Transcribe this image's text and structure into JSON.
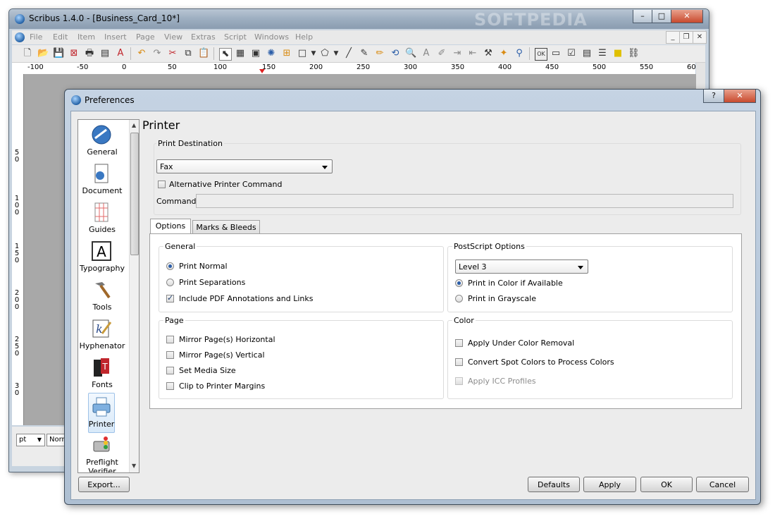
{
  "scribus": {
    "title": "Scribus 1.4.0 - [Business_Card_10*]",
    "menus": [
      "File",
      "Edit",
      "Item",
      "Insert",
      "Page",
      "View",
      "Extras",
      "Script",
      "Windows",
      "Help"
    ],
    "ruler_labels": [
      "-100",
      "-50",
      "0",
      "50",
      "100",
      "150",
      "200",
      "250",
      "300",
      "350",
      "400",
      "450",
      "500",
      "550",
      "60"
    ],
    "vruler_labels": [
      "5\n0",
      "1\n0\n0",
      "1\n5\n0",
      "2\n0\n0",
      "2\n5\n0",
      "3\n0"
    ],
    "units": "pt",
    "view_mode": "Norm",
    "window_controls": {
      "minimize": "–",
      "maximize": "□",
      "close": "✕"
    }
  },
  "watermark": "SOFTPEDIA",
  "prefs": {
    "title": "Preferences",
    "help_button": "?",
    "close_button": "✕",
    "sidebar": [
      "General",
      "Document",
      "Guides",
      "Typography",
      "Tools",
      "Hyphenator",
      "Fonts",
      "Printer",
      "Preflight Verifier"
    ],
    "selected": "Printer",
    "page_title": "Printer",
    "print_destination": {
      "title": "Print Destination",
      "selected": "Fax",
      "alt_command_label": "Alternative Printer Command",
      "alt_command_checked": false,
      "command_label": "Command:",
      "command_value": ""
    },
    "tabs": [
      "Options",
      "Marks & Bleeds"
    ],
    "active_tab": "Options",
    "general": {
      "title": "General",
      "options": [
        {
          "label": "Print Normal",
          "type": "radio",
          "checked": true
        },
        {
          "label": "Print Separations",
          "type": "radio",
          "checked": false
        },
        {
          "label": "Include PDF Annotations and Links",
          "type": "checkbox",
          "checked": true
        }
      ]
    },
    "postscript": {
      "title": "PostScript Options",
      "level": "Level 3",
      "options": [
        {
          "label": "Print in Color if Available",
          "checked": true
        },
        {
          "label": "Print in Grayscale",
          "checked": false
        }
      ]
    },
    "page": {
      "title": "Page",
      "options": [
        {
          "label": "Mirror Page(s) Horizontal",
          "checked": false
        },
        {
          "label": "Mirror Page(s) Vertical",
          "checked": false
        },
        {
          "label": "Set Media Size",
          "checked": false
        },
        {
          "label": "Clip to Printer Margins",
          "checked": false
        }
      ]
    },
    "color": {
      "title": "Color",
      "options": [
        {
          "label": "Apply Under Color Removal",
          "checked": false,
          "enabled": true
        },
        {
          "label": "Convert Spot Colors to Process Colors",
          "checked": false,
          "enabled": true
        },
        {
          "label": "Apply ICC Profiles",
          "checked": false,
          "enabled": false
        }
      ]
    },
    "buttons": {
      "export": "Export...",
      "defaults": "Defaults",
      "apply": "Apply",
      "ok": "OK",
      "cancel": "Cancel"
    }
  },
  "colors": {
    "accent": "#2a5da8",
    "selection": "#d8e9f9",
    "close_red": "#c84a2e"
  }
}
